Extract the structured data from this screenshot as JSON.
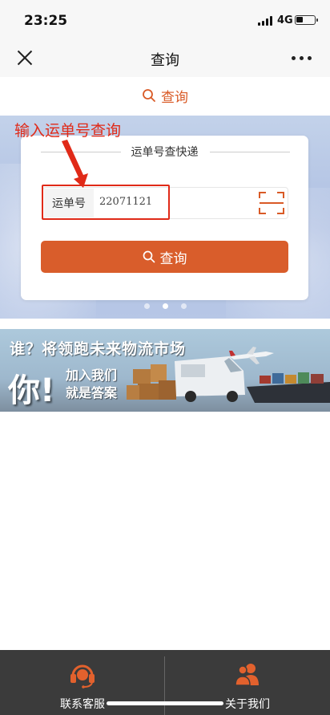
{
  "status_bar": {
    "time": "23:25",
    "network": "4G"
  },
  "nav": {
    "title": "查询"
  },
  "query_tab": {
    "label": "查询"
  },
  "annotation": {
    "text": "输入运单号查询"
  },
  "card": {
    "title": "运单号查快递",
    "waybill_label": "运单号",
    "waybill_value": "22071121",
    "search_label": "查询"
  },
  "carousel": {
    "count": 3,
    "active_index": 1
  },
  "promo": {
    "line1": "谁？将领跑未来物流市场",
    "big": "你!",
    "line2": "加入我们",
    "line3": "就是答案"
  },
  "bottom_nav": {
    "left_label": "联系客服",
    "right_label": "关于我们"
  },
  "colors": {
    "accent": "#d95d2b",
    "annotation": "#e02a18",
    "bottom_bar": "#3b3b3b"
  },
  "icons": {
    "close": "close-icon",
    "more": "more-icon",
    "search": "search-icon",
    "scan": "scan-icon",
    "headset": "headset-icon",
    "users": "users-icon"
  }
}
